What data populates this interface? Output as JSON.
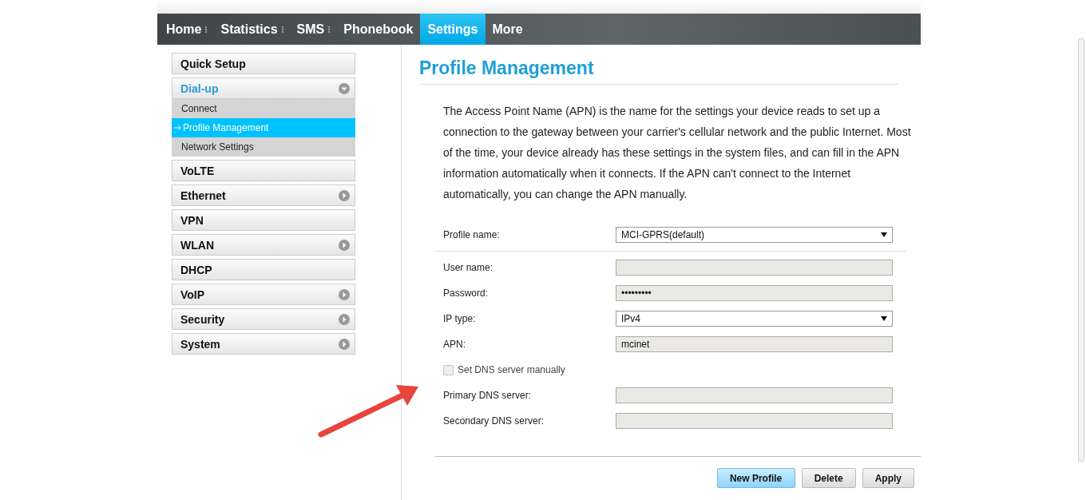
{
  "nav": {
    "tabs": [
      {
        "label": "Home",
        "selected": false
      },
      {
        "label": "Statistics",
        "selected": false
      },
      {
        "label": "SMS",
        "selected": false
      },
      {
        "label": "Phonebook",
        "selected": false
      },
      {
        "label": "Settings",
        "selected": true
      },
      {
        "label": "More",
        "selected": false
      }
    ]
  },
  "sidebar": {
    "items": [
      {
        "label": "Quick Setup",
        "kind": "link",
        "selected": false
      },
      {
        "label": "Dial-up",
        "kind": "group",
        "expanded": true,
        "selected": true,
        "children": [
          {
            "label": "Connect",
            "selected": false
          },
          {
            "label": "Profile Management",
            "selected": true
          },
          {
            "label": "Network Settings",
            "selected": false
          }
        ]
      },
      {
        "label": "VoLTE",
        "kind": "link",
        "selected": false
      },
      {
        "label": "Ethernet",
        "kind": "group",
        "expanded": false,
        "selected": false
      },
      {
        "label": "VPN",
        "kind": "link",
        "selected": false
      },
      {
        "label": "WLAN",
        "kind": "group",
        "expanded": false,
        "selected": false
      },
      {
        "label": "DHCP",
        "kind": "link",
        "selected": false
      },
      {
        "label": "VoIP",
        "kind": "group",
        "expanded": false,
        "selected": false
      },
      {
        "label": "Security",
        "kind": "group",
        "expanded": false,
        "selected": false
      },
      {
        "label": "System",
        "kind": "group",
        "expanded": false,
        "selected": false
      }
    ]
  },
  "content": {
    "title": "Profile Management",
    "description": "The Access Point Name (APN) is the name for the settings your device reads to set up a connection to the gateway between your carrier's cellular network and the public Internet. Most of the time, your device already has these settings in the system files, and can fill in the APN information automatically when it connects. If the APN can't connect to the Internet automatically, you can change the APN manually.",
    "fields": [
      {
        "label": "Profile name:",
        "kind": "select",
        "value": "MCI-GPRS(default)",
        "disabled": false
      },
      {
        "kind": "divider"
      },
      {
        "label": "User name:",
        "kind": "text",
        "disabled": true
      },
      {
        "label": "Password:",
        "kind": "text",
        "value": "•••••••••",
        "disabled": true
      },
      {
        "label": "IP type:",
        "kind": "select",
        "value": "IPv4",
        "disabled": false
      },
      {
        "label": "APN:",
        "kind": "text",
        "value": "mcinet",
        "disabled": true
      },
      {
        "label": "Set DNS server manually",
        "kind": "checkbox",
        "checked": false,
        "disabled": true
      },
      {
        "label": "Primary DNS server:",
        "kind": "text",
        "disabled": true
      },
      {
        "label": "Secondary DNS server:",
        "kind": "text",
        "disabled": true
      }
    ],
    "buttons": [
      {
        "label": "New Profile",
        "primary": true
      },
      {
        "label": "Delete",
        "primary": false
      },
      {
        "label": "Apply",
        "primary": false
      }
    ]
  }
}
